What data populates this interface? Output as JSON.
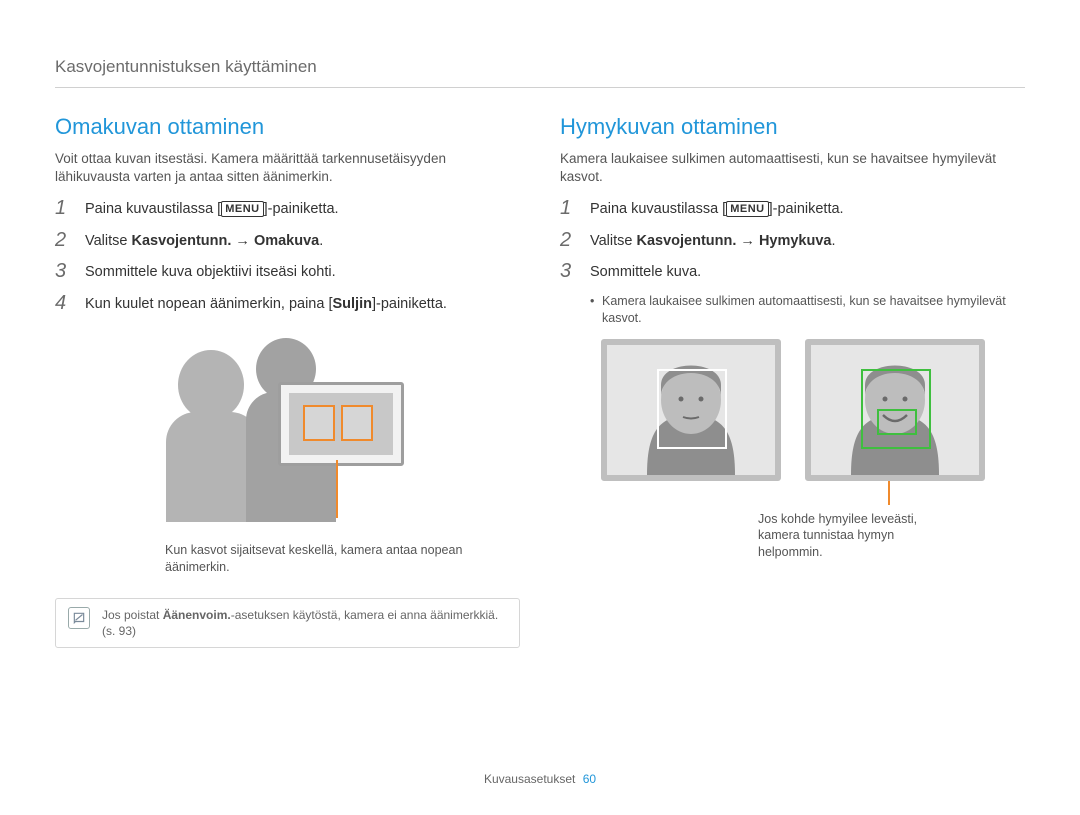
{
  "breadcrumb": "Kasvojentunnistuksen käyttäminen",
  "left": {
    "heading": "Omakuvan ottaminen",
    "intro": "Voit ottaa kuvan itsestäsi. Kamera määrittää tarkennusetäisyyden lähikuvausta varten ja antaa sitten äänimerkin.",
    "step1_a": "Paina kuvaustilassa [",
    "step1_menu": "MENU",
    "step1_b": "]-painiketta.",
    "step2_a": "Valitse ",
    "step2_bold": "Kasvojentunn. → Omakuva",
    "step2_b": ".",
    "step3": "Sommittele kuva objektiivi itseäsi kohti.",
    "step4_a": "Kun kuulet nopean äänimerkin, paina [",
    "step4_bold": "Suljin",
    "step4_b": "]-painiketta.",
    "caption": "Kun kasvot sijaitsevat keskellä, kamera antaa nopean äänimerkin.",
    "note_a": "Jos poistat ",
    "note_bold": "Äänenvoim.",
    "note_b": "-asetuksen käytöstä, kamera ei anna äänimerkkiä. (s. 93)"
  },
  "right": {
    "heading": "Hymykuvan ottaminen",
    "intro": "Kamera laukaisee sulkimen automaattisesti, kun se havaitsee hymyilevät kasvot.",
    "step1_a": "Paina kuvaustilassa [",
    "step1_menu": "MENU",
    "step1_b": "]-painiketta.",
    "step2_a": "Valitse ",
    "step2_bold": "Kasvojentunn. → Hymykuva",
    "step2_b": ".",
    "step3": "Sommittele kuva.",
    "sub": "Kamera laukaisee sulkimen automaattisesti, kun se havaitsee hymyilevät kasvot.",
    "caption": "Jos kohde hymyilee leveästi, kamera tunnistaa hymyn helpommin."
  },
  "footer_label": "Kuvausasetukset",
  "footer_page": "60"
}
